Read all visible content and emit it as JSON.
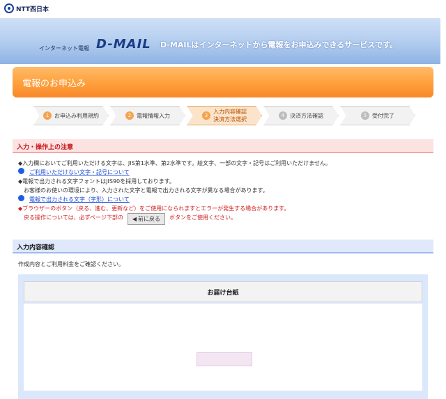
{
  "brand": {
    "name": "NTT西日本"
  },
  "hero": {
    "subtitle": "インターネット電報",
    "logo": "D-MAIL",
    "tagline": "D-MAILはインターネットから電報をお申込みできるサービスです。"
  },
  "page": {
    "title": "電報のお申込み"
  },
  "steps": [
    {
      "num": "1",
      "label": "お申込み利用規約",
      "state": "done"
    },
    {
      "num": "2",
      "label": "電報情報入力",
      "state": "done"
    },
    {
      "num": "3",
      "label": "入力内容確認\n決済方法選択",
      "state": "active"
    },
    {
      "num": "4",
      "label": "決済方法確認",
      "state": "todo"
    },
    {
      "num": "5",
      "label": "受付完了",
      "state": "todo"
    }
  ],
  "notice": {
    "title": "入力・操作上の注意",
    "items": [
      "◆入力欄においてご利用いただける文字は、JIS第1水準、第2水準です。絵文字、一部の文字・記号はご利用いただけません。",
      "ご利用いただけない文字・記号について",
      "◆電報で出力される文字フォントはJIS90を採用しております。",
      "お客様のお使いの環境により、入力された文字と電報で出力される文字が異なる場合があります。",
      "電報で出力される文字（字形）について",
      "◆ブラウザーのボタン（戻る、進む、更新など）をご使用になられますとエラーが発生する場合があります。",
      "戻る操作については、必ずページ下部の",
      "前に戻る",
      "ボタンをご使用ください。"
    ]
  },
  "section": {
    "title": "入力内容確認"
  },
  "intro": "作成内容とご利用料金をご確認ください。",
  "box": {
    "title": "お届け台紙"
  }
}
